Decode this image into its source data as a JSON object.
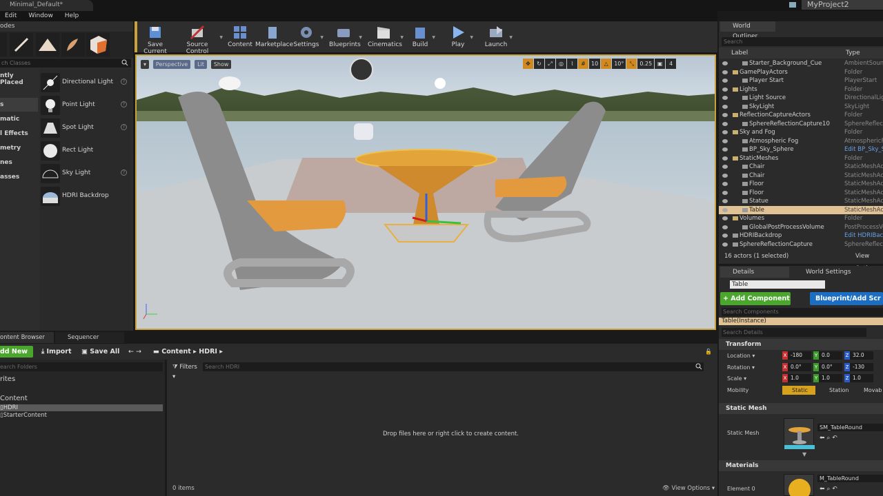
{
  "window": {
    "doc_tab": "Minimal_Default*",
    "project": "MyProject2",
    "menu": [
      "Edit",
      "Window",
      "Help"
    ]
  },
  "modes": {
    "tab": "odes",
    "search_placeholder": "ch Classes",
    "categories": [
      "ntly Placed",
      "",
      "s",
      "matic",
      "l Effects",
      "metry",
      "nes",
      "asses"
    ],
    "items": [
      {
        "label": "Directional Light",
        "icon": "directional-light-icon"
      },
      {
        "label": "Point Light",
        "icon": "point-light-icon"
      },
      {
        "label": "Spot Light",
        "icon": "spot-light-icon"
      },
      {
        "label": "Rect Light",
        "icon": "rect-light-icon"
      },
      {
        "label": "Sky Light",
        "icon": "sky-light-icon"
      },
      {
        "label": "HDRI Backdrop",
        "icon": "hdri-backdrop-icon"
      }
    ]
  },
  "toolbar": {
    "buttons": [
      {
        "label": "Save Current",
        "icon": "save-icon",
        "color": "#5b8fd6"
      },
      {
        "label": "Source Control",
        "icon": "source-control-icon",
        "color": "#b04040"
      },
      {
        "label": "Content",
        "icon": "content-icon",
        "color": "#6a8fcf"
      },
      {
        "label": "Marketplace",
        "icon": "marketplace-icon",
        "color": "#8aa6cf"
      },
      {
        "label": "Settings",
        "icon": "settings-icon",
        "color": "#7a8fb0"
      },
      {
        "label": "Blueprints",
        "icon": "blueprints-icon",
        "color": "#8a9ac0"
      },
      {
        "label": "Cinematics",
        "icon": "cinematics-icon",
        "color": "#cfcfcf"
      },
      {
        "label": "Build",
        "icon": "build-icon",
        "color": "#6a8fcf"
      },
      {
        "label": "Play",
        "icon": "play-icon",
        "color": "#8ab4f0"
      },
      {
        "label": "Launch",
        "icon": "launch-icon",
        "color": "#9aa8c0"
      }
    ]
  },
  "viewport": {
    "perspective": "Perspective",
    "lit": "Lit",
    "show": "Show",
    "grid_snap": "10",
    "rot_snap": "10°",
    "scale_snap": "0.25",
    "cam_speed": "4"
  },
  "outliner": {
    "tab": "World Outliner",
    "search_placeholder": "Search",
    "col_label": "Label",
    "col_type": "Type",
    "rows": [
      {
        "indent": 2,
        "label": "Starter_Background_Cue",
        "type": "AmbientSound",
        "folder": false
      },
      {
        "indent": 1,
        "label": "GamePlayActors",
        "type": "Folder",
        "folder": true
      },
      {
        "indent": 2,
        "label": "Player Start",
        "type": "PlayerStart",
        "folder": false
      },
      {
        "indent": 1,
        "label": "Lights",
        "type": "Folder",
        "folder": true
      },
      {
        "indent": 2,
        "label": "Light Source",
        "type": "DirectionalLight",
        "folder": false
      },
      {
        "indent": 2,
        "label": "SkyLight",
        "type": "SkyLight",
        "folder": false
      },
      {
        "indent": 1,
        "label": "ReflectionCaptureActors",
        "type": "Folder",
        "folder": true
      },
      {
        "indent": 2,
        "label": "SphereReflectionCapture10",
        "type": "SphereReflection",
        "folder": false
      },
      {
        "indent": 1,
        "label": "Sky and Fog",
        "type": "Folder",
        "folder": true
      },
      {
        "indent": 2,
        "label": "Atmospheric Fog",
        "type": "AtmosphericFog",
        "folder": false
      },
      {
        "indent": 2,
        "label": "BP_Sky_Sphere",
        "type": "Edit BP_Sky_S",
        "folder": false,
        "link": true
      },
      {
        "indent": 1,
        "label": "StaticMeshes",
        "type": "Folder",
        "folder": true
      },
      {
        "indent": 2,
        "label": "Chair",
        "type": "StaticMeshActor",
        "folder": false
      },
      {
        "indent": 2,
        "label": "Chair",
        "type": "StaticMeshActor",
        "folder": false
      },
      {
        "indent": 2,
        "label": "Floor",
        "type": "StaticMeshActor",
        "folder": false
      },
      {
        "indent": 2,
        "label": "Floor",
        "type": "StaticMeshActor",
        "folder": false
      },
      {
        "indent": 2,
        "label": "Statue",
        "type": "StaticMeshActor",
        "folder": false
      },
      {
        "indent": 2,
        "label": "Table",
        "type": "StaticMeshActor",
        "folder": false,
        "selected": true
      },
      {
        "indent": 1,
        "label": "Volumes",
        "type": "Folder",
        "folder": true
      },
      {
        "indent": 2,
        "label": "GlobalPostProcessVolume",
        "type": "PostProcessVol",
        "folder": false
      },
      {
        "indent": 1,
        "label": "HDRIBackdrop",
        "type": "Edit HDRIBack",
        "folder": false,
        "link": true
      },
      {
        "indent": 1,
        "label": "SphereReflectionCapture",
        "type": "SphereReflection",
        "folder": false
      }
    ],
    "footer": "16 actors (1 selected)",
    "view_options": "View Optio"
  },
  "details": {
    "tab": "Details",
    "tab2": "World Settings",
    "name": "Table",
    "add_component": "+ Add Component ▾",
    "blueprint": "Blueprint/Add Scr",
    "comp_search": "Search Components",
    "instance": "Table(Instance)",
    "search_details": "Search Details",
    "transform": "Transform",
    "location_label": "Location ▾",
    "rotation_label": "Rotation ▾",
    "scale_label": "Scale ▾",
    "mobility_label": "Mobility",
    "location": [
      "-180",
      "0.0",
      "32.0"
    ],
    "rotation": [
      "0.0°",
      "0.0°",
      "-130"
    ],
    "scale": [
      "1.0",
      "1.0",
      "1.0"
    ],
    "mobility": [
      "Static",
      "Station",
      "Movab"
    ],
    "static_mesh_section": "Static Mesh",
    "static_mesh_label": "Static Mesh",
    "static_mesh_value": "SM_TableRound",
    "materials_section": "Materials",
    "element_label": "Element 0",
    "material_value": "M_TableRound"
  },
  "content_browser": {
    "tab": "ontent Browser",
    "tab2": "Sequencer",
    "add_new": "dd New ▾",
    "import": "Import",
    "save_all": "Save All",
    "path": [
      "Content",
      "HDRI"
    ],
    "folder_search": "earch Folders",
    "favorites": "rites",
    "tree_root": "Content",
    "tree_items": [
      "HDRI",
      "StarterContent"
    ],
    "filters": "Filters ▾",
    "asset_search": "Search HDRI",
    "drop_hint": "Drop files here or right click to create content.",
    "items_count": "0 items",
    "view_options": "View Options ▾"
  }
}
